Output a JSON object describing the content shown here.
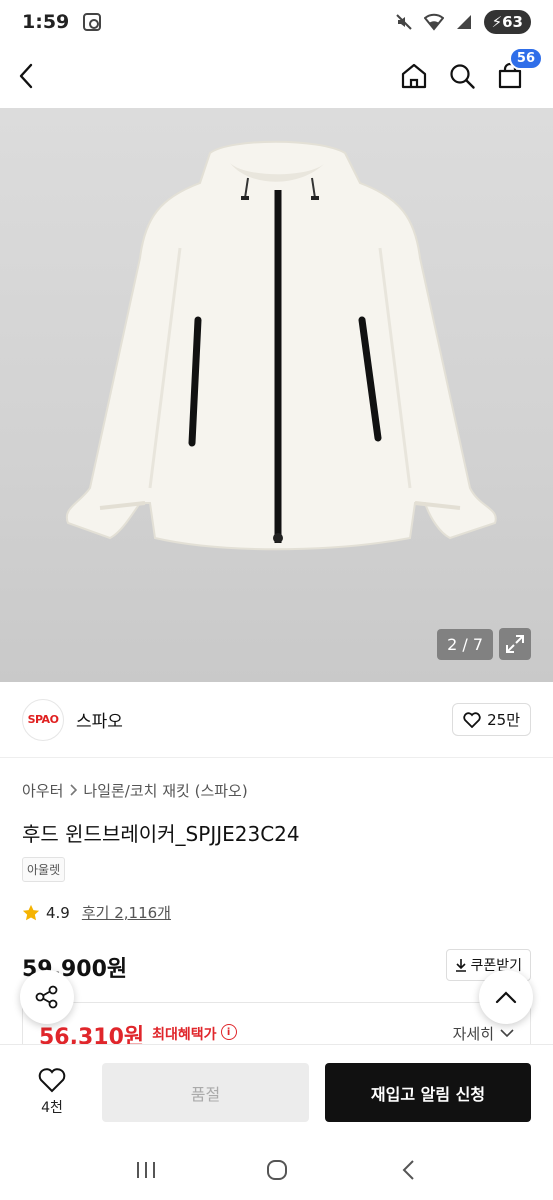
{
  "status_bar": {
    "time": "1:59",
    "battery": "63"
  },
  "header": {
    "cart_count": "56"
  },
  "gallery": {
    "counter": "2 / 7"
  },
  "brand": {
    "logo_text": "SPAO",
    "name": "스파오",
    "likes": "25만"
  },
  "breadcrumb": {
    "items": [
      "아우터",
      "나일론/코치 재킷 (스파오)"
    ]
  },
  "product": {
    "title": "후드 윈드브레이커_SPJJE23C24",
    "tag": "아울렛",
    "rating": "4.9",
    "review_link": "후기 2,116개",
    "price": "59,900원",
    "coupon_label": "쿠폰받기",
    "max_price": "56,310원",
    "max_label": "최대혜택가",
    "detail_label": "자세히"
  },
  "actions": {
    "wish_count": "4천",
    "soldout_label": "품절",
    "restock_label": "재입고 알림 신청"
  },
  "colors": {
    "accent_red": "#e0262b",
    "badge_blue": "#2f6ee9",
    "star": "#f5b301"
  },
  "icons": [
    "back-arrow-icon",
    "home-icon",
    "search-icon",
    "cart-icon",
    "expand-icon",
    "heart-icon",
    "star-icon",
    "download-icon",
    "info-icon",
    "chevron-down-icon",
    "share-icon",
    "chevron-up-icon",
    "recents-icon",
    "home-nav-icon",
    "back-nav-icon"
  ]
}
